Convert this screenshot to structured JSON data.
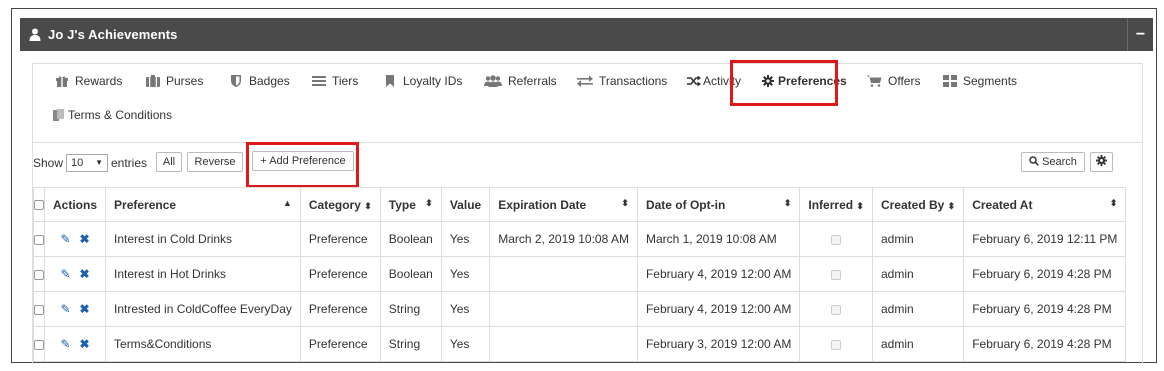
{
  "header": {
    "title": "Jo J's Achievements",
    "collapse": "−"
  },
  "tabs": [
    {
      "label": "Rewards",
      "icon": "gift-icon"
    },
    {
      "label": "Purses",
      "icon": "purse-icon"
    },
    {
      "label": "Badges",
      "icon": "shield-icon"
    },
    {
      "label": "Tiers",
      "icon": "tiers-icon"
    },
    {
      "label": "Loyalty IDs",
      "icon": "bookmark-icon"
    },
    {
      "label": "Referrals",
      "icon": "users-icon"
    },
    {
      "label": "Transactions",
      "icon": "exchange-icon"
    },
    {
      "label": "Activity",
      "icon": "random-icon"
    },
    {
      "label": "Preferences",
      "icon": "gear-icon"
    },
    {
      "label": "Offers",
      "icon": "cart-icon"
    },
    {
      "label": "Segments",
      "icon": "grid-icon"
    },
    {
      "label": "Terms & Conditions",
      "icon": "document-icon"
    }
  ],
  "toolbar": {
    "show_label": "Show",
    "entries_value": "10",
    "entries_label": "entries",
    "all_label": "All",
    "reverse_label": "Reverse",
    "add_label": "+ Add Preference",
    "search_label": "Search"
  },
  "table": {
    "columns": [
      "Actions",
      "Preference",
      "Category",
      "Type",
      "Value",
      "Expiration Date",
      "Date of Opt-in",
      "Inferred",
      "Created By",
      "Created At"
    ],
    "rows": [
      {
        "preference": "Interest in Cold Drinks",
        "category": "Preference",
        "type": "Boolean",
        "value": "Yes",
        "expiration": "March 2, 2019 10:08 AM",
        "optin": "March 1, 2019 10:08 AM",
        "created_by": "admin",
        "created_at": "February 6, 2019 12:11 PM"
      },
      {
        "preference": "Interest in Hot Drinks",
        "category": "Preference",
        "type": "Boolean",
        "value": "Yes",
        "expiration": "",
        "optin": "February 4, 2019 12:00 AM",
        "created_by": "admin",
        "created_at": "February 6, 2019 4:28 PM"
      },
      {
        "preference": "Intrested in ColdCoffee EveryDay",
        "category": "Preference",
        "type": "String",
        "value": "Yes",
        "expiration": "",
        "optin": "February 4, 2019 12:00 AM",
        "created_by": "admin",
        "created_at": "February 6, 2019 4:28 PM"
      },
      {
        "preference": "Terms&Conditions",
        "category": "Preference",
        "type": "String",
        "value": "Yes",
        "expiration": "",
        "optin": "February 3, 2019 12:00 AM",
        "created_by": "admin",
        "created_at": "February 6, 2019 4:28 PM"
      }
    ]
  },
  "colors": {
    "header_bg": "#4a4a4a",
    "highlight": "#e01818",
    "action_icon": "#1a5fb4"
  }
}
